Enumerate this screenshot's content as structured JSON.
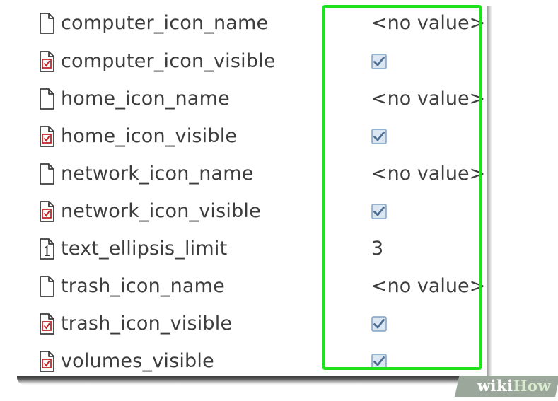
{
  "rows": [
    {
      "key": "computer_icon_name",
      "type": "string",
      "value": "<no value>"
    },
    {
      "key": "computer_icon_visible",
      "type": "boolean",
      "checked": true
    },
    {
      "key": "home_icon_name",
      "type": "string",
      "value": "<no value>"
    },
    {
      "key": "home_icon_visible",
      "type": "boolean",
      "checked": true
    },
    {
      "key": "network_icon_name",
      "type": "string",
      "value": "<no value>"
    },
    {
      "key": "network_icon_visible",
      "type": "boolean",
      "checked": true
    },
    {
      "key": "text_ellipsis_limit",
      "type": "integer",
      "value": "3"
    },
    {
      "key": "trash_icon_name",
      "type": "string",
      "value": "<no value>"
    },
    {
      "key": "trash_icon_visible",
      "type": "boolean",
      "checked": true
    },
    {
      "key": "volumes_visible",
      "type": "boolean",
      "checked": true
    }
  ],
  "watermark": {
    "part1": "wiki",
    "part2": "How"
  },
  "colors": {
    "highlight": "#20e020",
    "text": "#3d3d3d",
    "checkbox": "#7fa0c8"
  }
}
